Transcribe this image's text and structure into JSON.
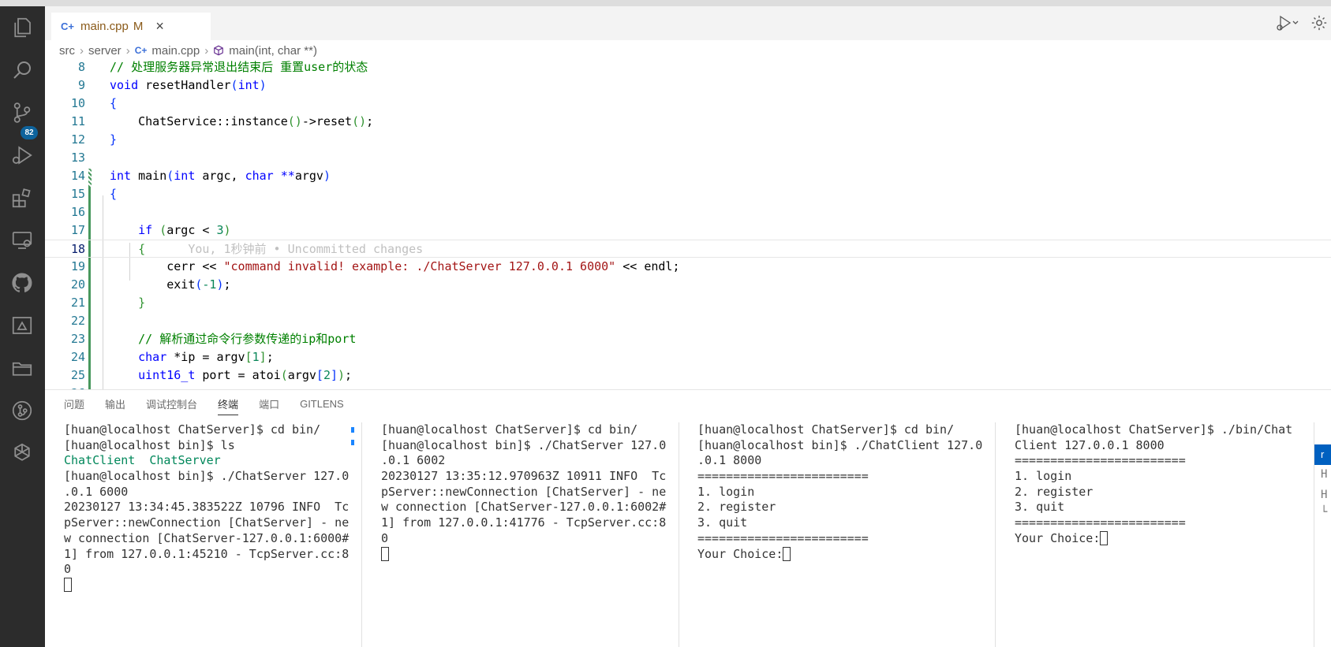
{
  "tab": {
    "lang_icon": "C+",
    "filename": "main.cpp",
    "status": "M",
    "close": "×"
  },
  "breadcrumb": {
    "items": [
      "src",
      "server",
      "main.cpp",
      "main(int, char **)"
    ]
  },
  "blame": "You, 1秒钟前 • Uncommitted changes",
  "activity_badge": "82",
  "editor": {
    "lines": [
      {
        "num": "8",
        "segments": [
          {
            "text": "// 处理服务器异常退出结束后 重置user的状态",
            "cls": "cm"
          }
        ]
      },
      {
        "num": "9",
        "segments": [
          {
            "text": "void",
            "cls": "kw"
          },
          {
            "text": " resetHandler"
          },
          {
            "text": "(",
            "cls": "br1"
          },
          {
            "text": "int",
            "cls": "kw"
          },
          {
            "text": ")",
            "cls": "br1"
          }
        ]
      },
      {
        "num": "10",
        "segments": [
          {
            "text": "{",
            "cls": "br1"
          }
        ]
      },
      {
        "num": "11",
        "segments": [
          {
            "text": "    ChatService::instance"
          },
          {
            "text": "()",
            "cls": "br2"
          },
          {
            "text": "->reset"
          },
          {
            "text": "()",
            "cls": "br2"
          },
          {
            "text": ";"
          }
        ]
      },
      {
        "num": "12",
        "segments": [
          {
            "text": "}",
            "cls": "br1"
          }
        ]
      },
      {
        "num": "13",
        "segments": []
      },
      {
        "num": "14",
        "segments": [
          {
            "text": "int",
            "cls": "kw"
          },
          {
            "text": " main"
          },
          {
            "text": "(",
            "cls": "br1"
          },
          {
            "text": "int",
            "cls": "kw"
          },
          {
            "text": " argc, "
          },
          {
            "text": "char",
            "cls": "kw"
          },
          {
            "text": " **",
            "cls": "kw"
          },
          {
            "text": "argv"
          },
          {
            "text": ")",
            "cls": "br1"
          }
        ]
      },
      {
        "num": "15",
        "segments": [
          {
            "text": "{",
            "cls": "br1"
          }
        ]
      },
      {
        "num": "16",
        "segments": []
      },
      {
        "num": "17",
        "segments": [
          {
            "text": "    "
          },
          {
            "text": "if",
            "cls": "kw"
          },
          {
            "text": " "
          },
          {
            "text": "(",
            "cls": "br2"
          },
          {
            "text": "argc < "
          },
          {
            "text": "3",
            "cls": "num"
          },
          {
            "text": ")",
            "cls": "br2"
          }
        ]
      },
      {
        "num": "18",
        "segments": [
          {
            "text": "    "
          },
          {
            "text": "{",
            "cls": "br2"
          },
          {
            "text": "      "
          },
          {
            "text": "You, 1秒钟前 • Uncommitted changes",
            "cls": "ghost"
          }
        ]
      },
      {
        "num": "19",
        "segments": [
          {
            "text": "        cerr << "
          },
          {
            "text": "\"command invalid! example: ./ChatServer 127.0.0.1 6000\"",
            "cls": "str"
          },
          {
            "text": " << endl;"
          }
        ]
      },
      {
        "num": "20",
        "segments": [
          {
            "text": "        exit"
          },
          {
            "text": "(",
            "cls": "br1"
          },
          {
            "text": "-1",
            "cls": "num"
          },
          {
            "text": ")",
            "cls": "br1"
          },
          {
            "text": ";"
          }
        ]
      },
      {
        "num": "21",
        "segments": [
          {
            "text": "    "
          },
          {
            "text": "}",
            "cls": "br2"
          }
        ]
      },
      {
        "num": "22",
        "segments": []
      },
      {
        "num": "23",
        "segments": [
          {
            "text": "    "
          },
          {
            "text": "// 解析通过命令行参数传递的ip和port",
            "cls": "cm"
          }
        ]
      },
      {
        "num": "24",
        "segments": [
          {
            "text": "    "
          },
          {
            "text": "char",
            "cls": "kw"
          },
          {
            "text": " *ip = argv"
          },
          {
            "text": "[",
            "cls": "br2"
          },
          {
            "text": "1",
            "cls": "num"
          },
          {
            "text": "]",
            "cls": "br2"
          },
          {
            "text": ";"
          }
        ]
      },
      {
        "num": "25",
        "segments": [
          {
            "text": "    "
          },
          {
            "text": "uint16_t",
            "cls": "kw"
          },
          {
            "text": " port = atoi"
          },
          {
            "text": "(",
            "cls": "br2"
          },
          {
            "text": "argv"
          },
          {
            "text": "[",
            "cls": "br1"
          },
          {
            "text": "2",
            "cls": "num"
          },
          {
            "text": "]",
            "cls": "br1"
          },
          {
            "text": ")",
            "cls": "br2"
          },
          {
            "text": ";"
          }
        ]
      },
      {
        "num": "26",
        "segments": []
      }
    ]
  },
  "panel": {
    "tabs": [
      "问题",
      "输出",
      "调试控制台",
      "终端",
      "端口",
      "GITLENS"
    ],
    "active": "终端"
  },
  "terminals": [
    {
      "lines": [
        {
          "text": "[huan@localhost ChatServer]$ cd bin/",
          "dot": "blue"
        },
        {
          "text": "[huan@localhost bin]$ ls",
          "dot": "blue"
        },
        {
          "text": "ChatClient  ChatServer",
          "cls": "green"
        },
        {
          "text": "[huan@localhost bin]$ ./ChatServer 127.0",
          "dot": "hollow"
        },
        {
          "text": ".0.1 6000"
        },
        {
          "text": "20230127 13:34:45.383522Z 10796 INFO  Tc"
        },
        {
          "text": "pServer::newConnection [ChatServer] - ne"
        },
        {
          "text": "w connection [ChatServer-127.0.0.1:6000#"
        },
        {
          "text": "1] from 127.0.0.1:45210 - TcpServer.cc:8"
        },
        {
          "text": "0"
        },
        {
          "text": "",
          "cursor": true
        }
      ]
    },
    {
      "lines": [
        {
          "text": "[huan@localhost ChatServer]$ cd bin/",
          "dot": "blue"
        },
        {
          "text": "[huan@localhost bin]$ ./ChatServer 127.0",
          "dot": "hollow"
        },
        {
          "text": ".0.1 6002"
        },
        {
          "text": "20230127 13:35:12.970963Z 10911 INFO  Tc"
        },
        {
          "text": "pServer::newConnection [ChatServer] - ne"
        },
        {
          "text": "w connection [ChatServer-127.0.0.1:6002#"
        },
        {
          "text": "1] from 127.0.0.1:41776 - TcpServer.cc:8"
        },
        {
          "text": "0"
        },
        {
          "text": "",
          "cursor": true
        }
      ]
    },
    {
      "lines": [
        {
          "text": "[huan@localhost ChatServer]$ cd bin/",
          "dot": "blue"
        },
        {
          "text": "[huan@localhost bin]$ ./ChatClient 127.0",
          "dot": "hollow"
        },
        {
          "text": ".0.1 8000"
        },
        {
          "text": "========================"
        },
        {
          "text": "1. login"
        },
        {
          "text": "2. register"
        },
        {
          "text": "3. quit"
        },
        {
          "text": "========================"
        },
        {
          "text": "Your Choice:",
          "cursor": true
        }
      ]
    },
    {
      "lines": [
        {
          "text": "[huan@localhost ChatServer]$ ./bin/Chat",
          "dot": "hollow"
        },
        {
          "text": "Client 127.0.0.1 8000"
        },
        {
          "text": "========================"
        },
        {
          "text": "1. login"
        },
        {
          "text": "2. register"
        },
        {
          "text": "3. quit"
        },
        {
          "text": "========================"
        },
        {
          "text": "Your Choice:",
          "cursor": true
        }
      ]
    }
  ],
  "terminal_list": {
    "selected": "r",
    "items": [
      "H",
      "H",
      "└"
    ]
  },
  "colors": {
    "accent": "#0e639c",
    "activity_bg": "#2c2c2c",
    "added_gutter": "#48985d"
  }
}
